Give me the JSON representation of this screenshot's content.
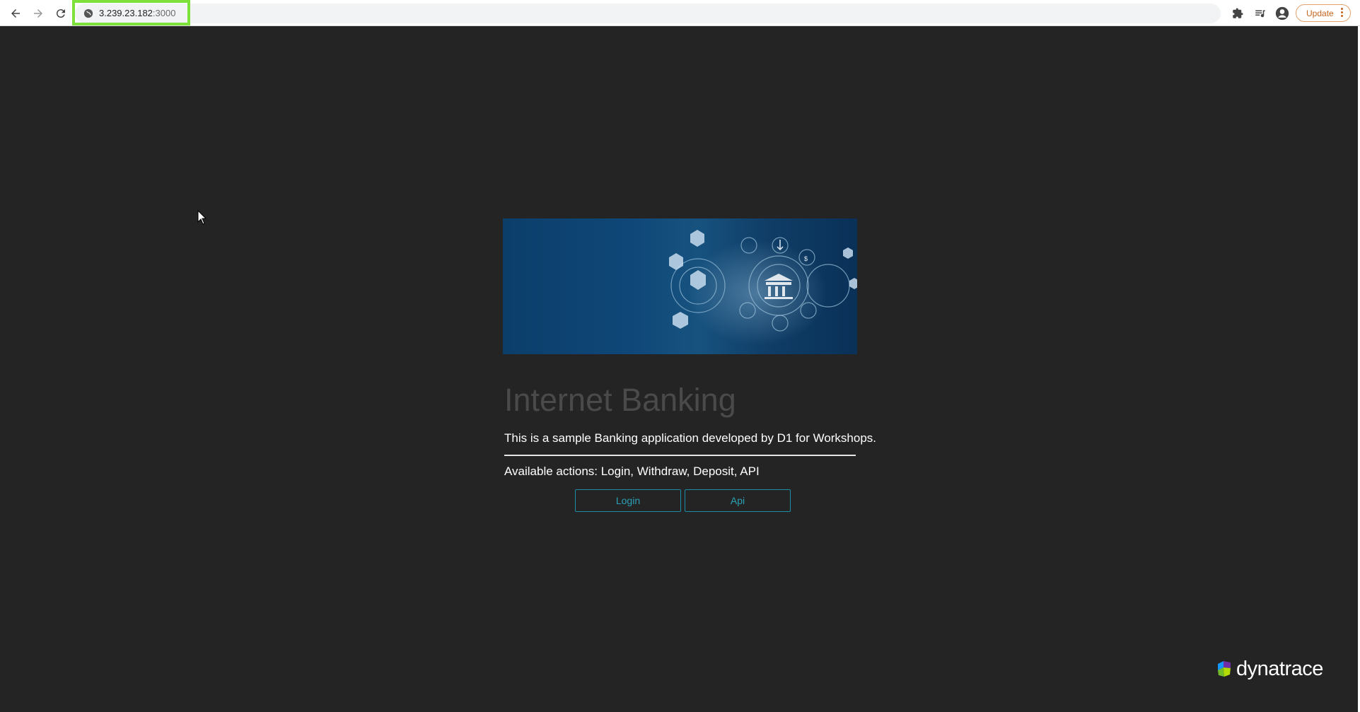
{
  "browser": {
    "url_host": "3.239.23.182",
    "url_port": ":3000",
    "update_label": "Update"
  },
  "hero": {
    "image": "banking-technology-hero-image"
  },
  "main": {
    "title": "Internet Banking",
    "description": "This is a sample Banking application developed by D1 for Workshops.",
    "actions_text": "Available actions: Login, Withdraw, Deposit, API",
    "buttons": {
      "login": "Login",
      "api": "Api"
    }
  },
  "branding": {
    "logo_text": "dynatrace"
  },
  "colors": {
    "page_background": "#242424",
    "title": "#4a4a4a",
    "button_accent": "#2aa0b6",
    "url_highlight": "#7ee03a",
    "update_accent": "#c5651f"
  }
}
